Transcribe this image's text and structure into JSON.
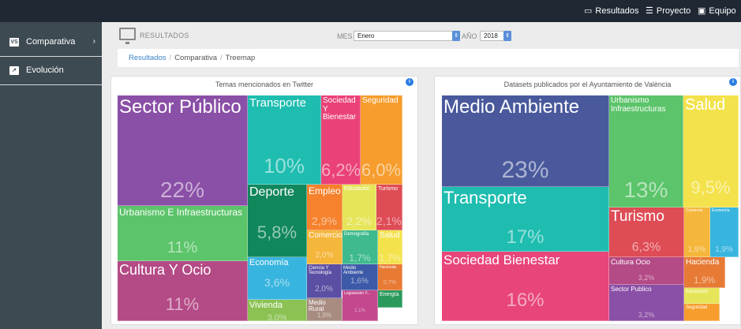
{
  "topnav": {
    "items": [
      {
        "label": "Resultados",
        "icon": "monitor-icon",
        "color": "#3b83c6"
      },
      {
        "label": "Proyecto",
        "icon": "list-icon",
        "color": "#ffffff"
      },
      {
        "label": "Equipo",
        "icon": "team-icon",
        "color": "#ffffff"
      }
    ]
  },
  "sidebar": {
    "items": [
      {
        "label": "Comparativa",
        "icon": "vs-icon",
        "arrow": "›"
      },
      {
        "label": "Evolución",
        "icon": "chart-icon"
      }
    ]
  },
  "header": {
    "section": "RESULTADOS",
    "month_label": "MES",
    "month_value": "Enero",
    "year_label": "AÑO",
    "year_value": "2018"
  },
  "breadcrumb": {
    "items": [
      "Resultados",
      "Comparativa",
      "Treemap"
    ]
  },
  "chart_data": [
    {
      "type": "treemap",
      "title": "Temas mencionados en Twitter",
      "items": [
        {
          "name": "Sector Público",
          "value": "22%",
          "color": "#8a4fa6"
        },
        {
          "name": "Urbanismo E Infraestructuras",
          "value": "11%",
          "color": "#5cc46a"
        },
        {
          "name": "Cultura Y Ocio",
          "value": "11%",
          "color": "#b44a86"
        },
        {
          "name": "Transporte",
          "value": "10%",
          "color": "#1ebdb0"
        },
        {
          "name": "Sociedad Y Bienestar",
          "value": "6,2%",
          "color": "#ea4277"
        },
        {
          "name": "Seguridad",
          "value": "6,0%",
          "color": "#f69d2d"
        },
        {
          "name": "Deporte",
          "value": "5,8%",
          "color": "#11875c"
        },
        {
          "name": "Empleo",
          "value": "2,9%",
          "color": "#f6822d"
        },
        {
          "name": "Educación",
          "value": "2,2%",
          "color": "#e6e55a"
        },
        {
          "name": "Turismo",
          "value": "2,1%",
          "color": "#de4c55"
        },
        {
          "name": "Comercio",
          "value": "2,0%",
          "color": "#f5b63c"
        },
        {
          "name": "Demografía",
          "value": "1,7%",
          "color": "#3fba8f"
        },
        {
          "name": "Salud",
          "value": "1,7%",
          "color": "#f3e24c"
        },
        {
          "name": "Economía",
          "value": "3,6%",
          "color": "#38b5df"
        },
        {
          "name": "Ciencia Y Tecnología",
          "value": "2,0%",
          "color": "#5b4fa4"
        },
        {
          "name": "Medio Ambiente",
          "value": "1,6%",
          "color": "#3d5aa8"
        },
        {
          "name": "Hacienda",
          "value": "0,7%",
          "color": "#e77a35"
        },
        {
          "name": "Vivienda",
          "value": "3,0%",
          "color": "#8cc254"
        },
        {
          "name": "Medio Rural",
          "value": "1,9%",
          "color": "#a88c82"
        },
        {
          "name": "Legislación Y...",
          "value": "1,1%",
          "color": "#c4488d"
        },
        {
          "name": "Energía",
          "value": "",
          "color": "#2a9a5c"
        }
      ]
    },
    {
      "type": "treemap",
      "title": "Datasets publicados por el Ayuntamiento de València",
      "items": [
        {
          "name": "Medio Ambiente",
          "value": "23%",
          "color": "#49599c"
        },
        {
          "name": "Transporte",
          "value": "17%",
          "color": "#1ebdb0"
        },
        {
          "name": "Sociedad Bienestar",
          "value": "16%",
          "color": "#e8457a"
        },
        {
          "name": "Urbanismo Infraestructuras",
          "value": "13%",
          "color": "#5cc46a"
        },
        {
          "name": "Salud",
          "value": "9,5%",
          "color": "#f3e24c"
        },
        {
          "name": "Turismo",
          "value": "6,3%",
          "color": "#de4c55"
        },
        {
          "name": "Comercio",
          "value": "1,9%",
          "color": "#f5b63c"
        },
        {
          "name": "Economía",
          "value": "1,9%",
          "color": "#38b5df"
        },
        {
          "name": "Cultura Ocio",
          "value": "3,2%",
          "color": "#b44a86"
        },
        {
          "name": "Hacienda",
          "value": "1,9%",
          "color": "#e77a35"
        },
        {
          "name": "Sector Publico",
          "value": "3,2%",
          "color": "#8a4fa6"
        },
        {
          "name": "Educación",
          "value": "",
          "color": "#e6e55a"
        },
        {
          "name": "Seguridad",
          "value": "",
          "color": "#f69d2d"
        }
      ]
    }
  ]
}
